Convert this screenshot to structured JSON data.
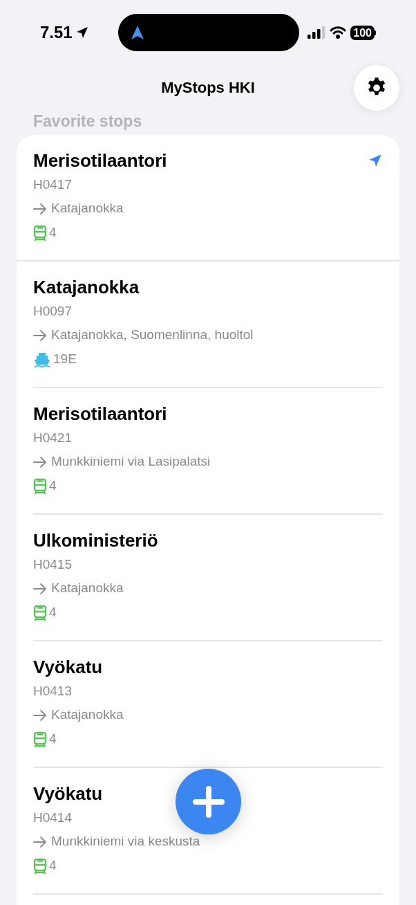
{
  "status_bar": {
    "time": "7.51",
    "battery": "100"
  },
  "header": {
    "title": "MyStops HKI"
  },
  "section": {
    "title": "Favorite stops"
  },
  "stops": [
    {
      "name": "Merisotilaantori",
      "code": "H0417",
      "direction": "Katajanokka",
      "kind": "tram",
      "route": "4",
      "nearby": true
    },
    {
      "name": "Katajanokka",
      "code": "H0097",
      "direction": "Katajanokka, Suomenlinna, huoltol",
      "kind": "ferry",
      "route": "19E",
      "nearby": false
    },
    {
      "name": "Merisotilaantori",
      "code": "H0421",
      "direction": "Munkkiniemi via Lasipalatsi",
      "kind": "tram",
      "route": "4",
      "nearby": false
    },
    {
      "name": "Ulkoministeriö",
      "code": "H0415",
      "direction": "Katajanokka",
      "kind": "tram",
      "route": "4",
      "nearby": false
    },
    {
      "name": "Vyökatu",
      "code": "H0413",
      "direction": "Katajanokka",
      "kind": "tram",
      "route": "4",
      "nearby": false
    },
    {
      "name": "Vyökatu",
      "code": "H0414",
      "direction": "Munkkiniemi via keskusta",
      "kind": "tram",
      "route": "4",
      "nearby": false
    }
  ]
}
